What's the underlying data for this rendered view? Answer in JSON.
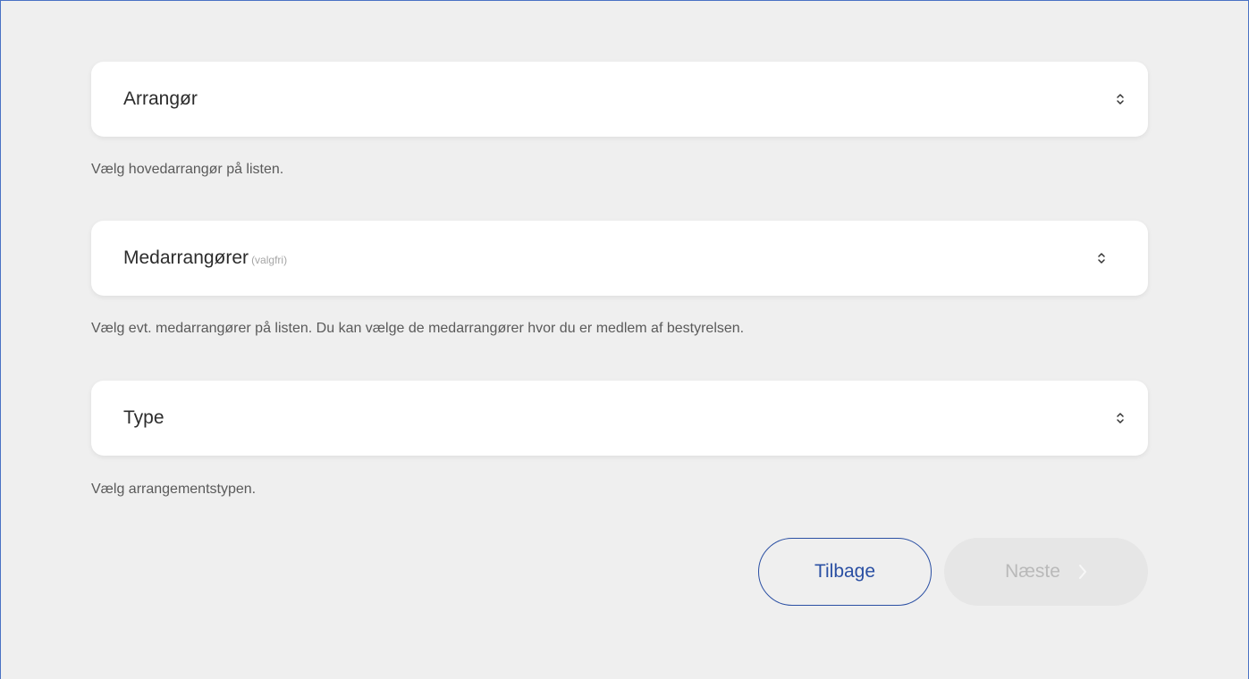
{
  "form": {
    "organizer": {
      "label": "Arrangør",
      "help": "Vælg hovedarrangør på listen."
    },
    "co_organizers": {
      "label": "Medarrangører",
      "optional_tag": "(valgfri)",
      "help": "Vælg evt. medarrangører på listen. Du kan vælge de medarrangører hvor du er medlem af bestyrelsen."
    },
    "type": {
      "label": "Type",
      "help": "Vælg arrangementstypen."
    }
  },
  "actions": {
    "back_label": "Tilbage",
    "next_label": "Næste"
  },
  "colors": {
    "accent": "#2a4fa3",
    "background": "#efefef",
    "disabled_bg": "#e6e6e6",
    "disabled_text": "#b9b9b9"
  },
  "icons": {
    "select_indicator": "up-down-chevron-icon",
    "next_indicator": "chevron-right-icon"
  }
}
